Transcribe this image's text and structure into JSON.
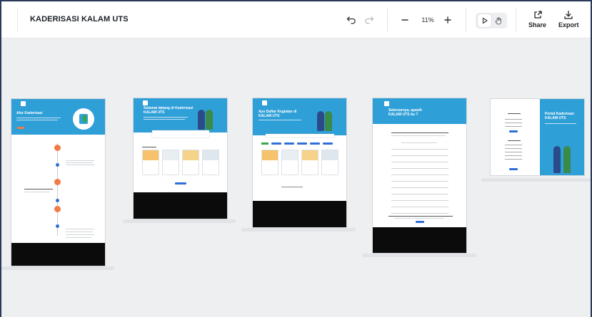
{
  "project": {
    "title": "KADERISASI KALAM UTS"
  },
  "toolbar": {
    "zoom_level": "11%",
    "share_label": "Share",
    "export_label": "Export",
    "icons": {
      "undo": "undo-icon",
      "redo": "redo-icon",
      "zoom_out": "minus-icon",
      "zoom_in": "plus-icon",
      "select": "pointer-icon",
      "pan": "hand-icon",
      "share": "share-icon",
      "export": "download-icon"
    }
  },
  "boards": [
    {
      "heading": "Alur Kaderisasi"
    },
    {
      "heading": "Selamat datang di Kaderisasi KALAM UTS"
    },
    {
      "heading": "Ayo Daftar Kegiatan di KALAM UTS"
    },
    {
      "heading": "Sebenarnya, apasih KALAM UTS itu ?"
    },
    {
      "heading": "Portal Kaderisasi KALAM UTS"
    }
  ],
  "colors": {
    "brand_blue": "#2f9fd8",
    "footer_black": "#0b0b0b",
    "accent_orange": "#f07c45",
    "button_blue": "#2f6fd8",
    "canvas_bg": "#eeeff1"
  }
}
